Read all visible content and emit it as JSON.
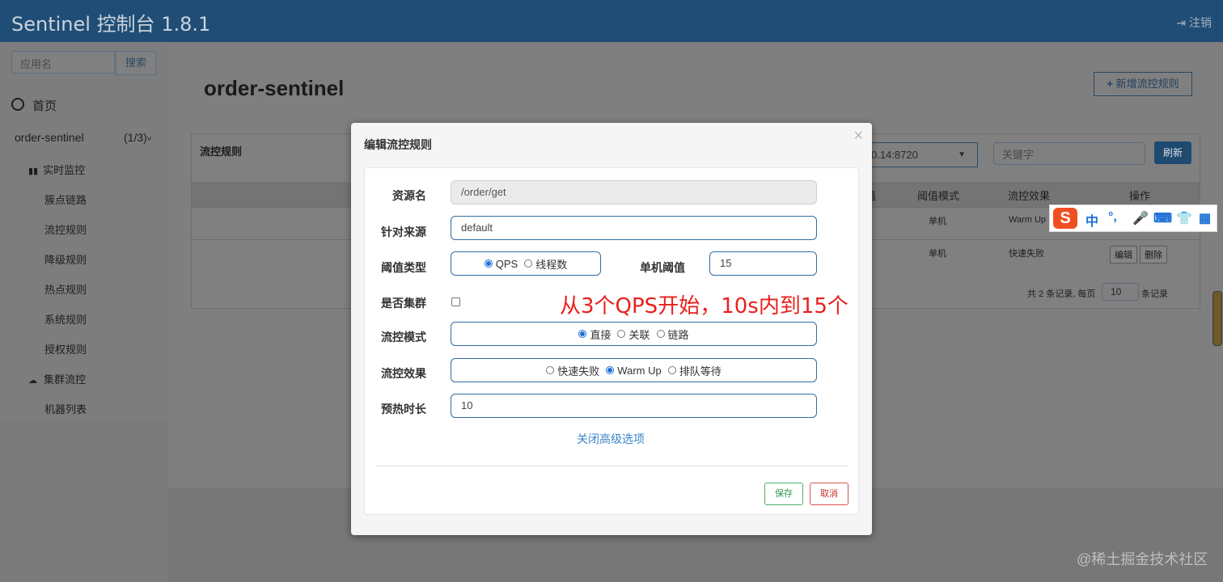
{
  "header": {
    "title": "Sentinel 控制台 1.8.1",
    "logout_label": "注销",
    "logout_icon": "sign-out-icon"
  },
  "sidebar": {
    "search_placeholder": "应用名",
    "search_button": "搜索",
    "home_label": "首页",
    "app_name": "order-sentinel",
    "app_count": "(1/3)",
    "items": [
      {
        "label": "实时监控",
        "icon": "bar-chart-icon"
      },
      {
        "label": "簇点链路"
      },
      {
        "label": "流控规则"
      },
      {
        "label": "降级规则"
      },
      {
        "label": "热点规则"
      },
      {
        "label": "系统规则"
      },
      {
        "label": "授权规则"
      },
      {
        "label": "集群流控",
        "icon": "cloud-icon"
      },
      {
        "label": "机器列表"
      }
    ]
  },
  "main": {
    "app_title": "order-sentinel",
    "add_rule_button": "新增流控规则",
    "panel_title": "流控规则",
    "machine_select": "0.14:8720",
    "keyword_placeholder": "关键字",
    "refresh_button": "刷新",
    "table": {
      "headers": [
        "值",
        "阈值模式",
        "流控效果",
        "操作"
      ],
      "rows": [
        {
          "mode": "单机",
          "effect": "Warm Up"
        },
        {
          "mode": "单机",
          "effect": "快速失败",
          "edit": "编辑",
          "delete": "删除"
        }
      ]
    },
    "pager": {
      "prefix": "共 2 条记录, 每页",
      "page_size": "10",
      "suffix": "条记录"
    }
  },
  "modal": {
    "title": "编辑流控规则",
    "close": "×",
    "fields": {
      "resource_label": "资源名",
      "resource_value": "/order/get",
      "origin_label": "针对来源",
      "origin_value": "default",
      "threshold_type_label": "阈值类型",
      "threshold_type_options": [
        "QPS",
        "线程数"
      ],
      "threshold_type_selected": "QPS",
      "single_threshold_label": "单机阈值",
      "single_threshold_value": "15",
      "cluster_label": "是否集群",
      "mode_label": "流控模式",
      "mode_options": [
        "直接",
        "关联",
        "链路"
      ],
      "mode_selected": "直接",
      "effect_label": "流控效果",
      "effect_options": [
        "快速失败",
        "Warm Up",
        "排队等待"
      ],
      "effect_selected": "Warm Up",
      "warmup_label": "预热时长",
      "warmup_value": "10"
    },
    "annotation": "从3个QPS开始，10s内到15个",
    "advanced_link": "关闭高级选项",
    "save_button": "保存",
    "cancel_button": "取消"
  },
  "ime_toolbar": {
    "logo": "S",
    "lang": "中",
    "punct": "°,",
    "icons": [
      "microphone-icon",
      "keyboard-icon",
      "shirt-icon",
      "grid-icon"
    ]
  },
  "watermark": "@稀土掘金技术社区"
}
